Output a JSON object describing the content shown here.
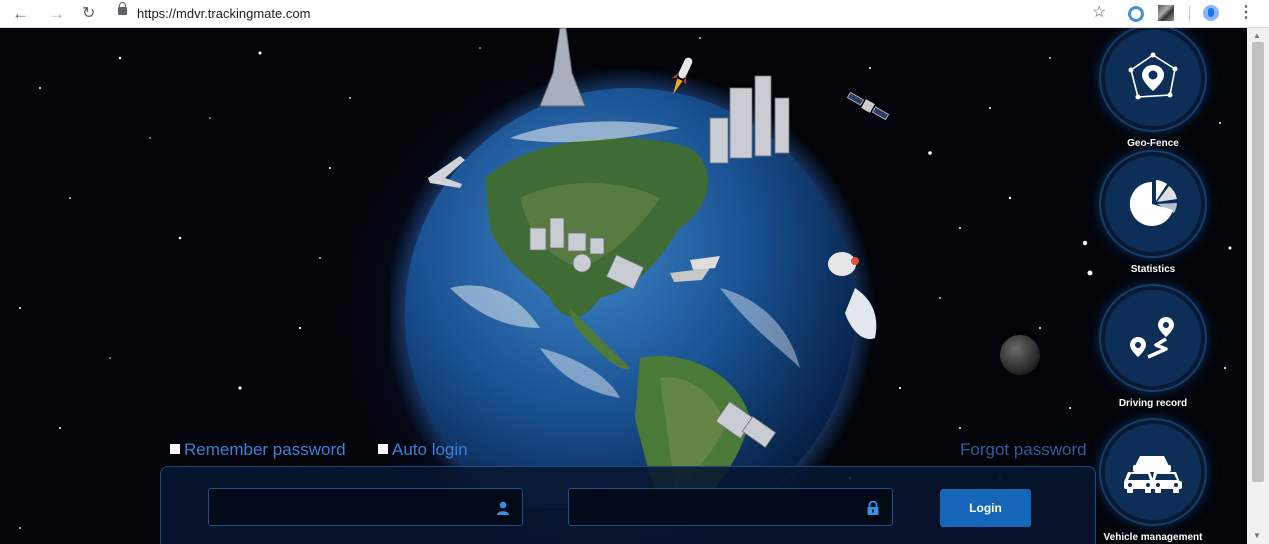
{
  "browser": {
    "back_icon": "back-arrow-icon",
    "forward_icon": "forward-arrow-icon",
    "reload_icon": "reload-icon",
    "url": "https://mdvr.trackingmate.com"
  },
  "features": [
    {
      "label": "Geo-Fence",
      "icon": "geofence-pin-icon"
    },
    {
      "label": "Statistics",
      "icon": "pie-chart-icon"
    },
    {
      "label": "Driving record",
      "icon": "route-icon"
    },
    {
      "label": "Vehicle management",
      "icon": "cars-icon"
    }
  ],
  "login": {
    "remember_password": "Remember password",
    "auto_login": "Auto login",
    "forgot_password": "Forgot password",
    "username_value": "",
    "password_value": "",
    "login_button": "Login"
  },
  "colors": {
    "accent": "#1366b8",
    "link": "#3d7fd9",
    "panel_border": "#1c4a82"
  }
}
